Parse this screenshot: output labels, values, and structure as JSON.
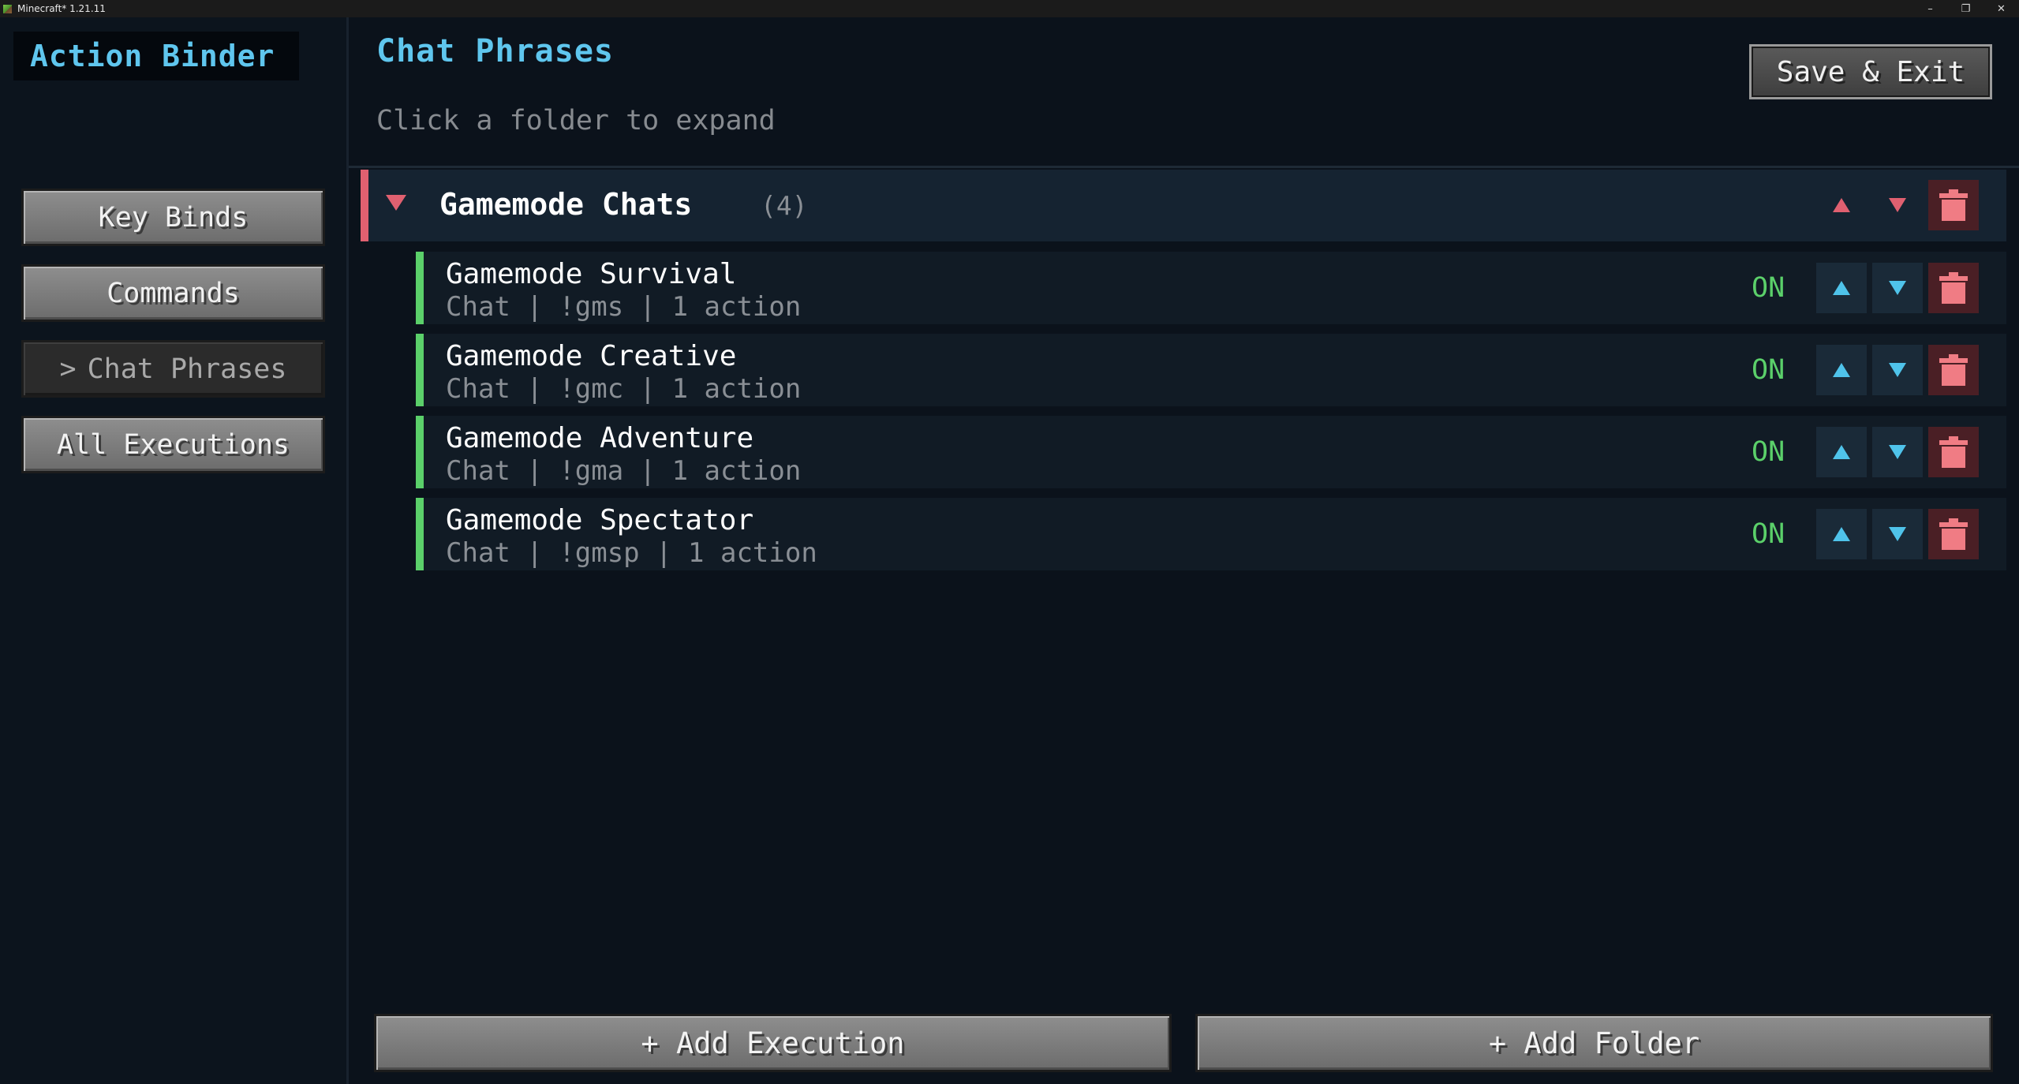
{
  "window": {
    "title": "Minecraft* 1.21.11",
    "controls": {
      "minimize": "–",
      "restore": "❐",
      "close": "✕"
    }
  },
  "sidebar": {
    "brand": "Action Binder",
    "items": [
      {
        "label": "Key Binds",
        "active": false
      },
      {
        "label": "Commands",
        "active": false
      },
      {
        "label": "Chat Phrases",
        "prefix": ">",
        "active": true
      },
      {
        "label": "All Executions",
        "active": false
      }
    ]
  },
  "main": {
    "title": "Chat Phrases",
    "subtitle": "Click a folder to expand",
    "save_label": "Save & Exit",
    "folder": {
      "name": "Gamemode Chats",
      "count": "(4)",
      "expanded": true,
      "color": "#e06070"
    },
    "executions": [
      {
        "name": "Gamemode Survival",
        "meta": "Chat | !gms  |  1 action",
        "status": "ON"
      },
      {
        "name": "Gamemode Creative",
        "meta": "Chat | !gmc  |  1 action",
        "status": "ON"
      },
      {
        "name": "Gamemode Adventure",
        "meta": "Chat | !gma  |  1 action",
        "status": "ON"
      },
      {
        "name": "Gamemode Spectator",
        "meta": "Chat | !gmsp  |  1 action",
        "status": "ON"
      }
    ],
    "add_execution_label": "+ Add Execution",
    "add_folder_label": "+ Add Folder"
  },
  "colors": {
    "accent": "#5fc6ee",
    "status_on": "#5bd06a",
    "delete": "#f07c84",
    "folder_up_down": "#e06070",
    "item_up_down": "#4fc3ea"
  }
}
